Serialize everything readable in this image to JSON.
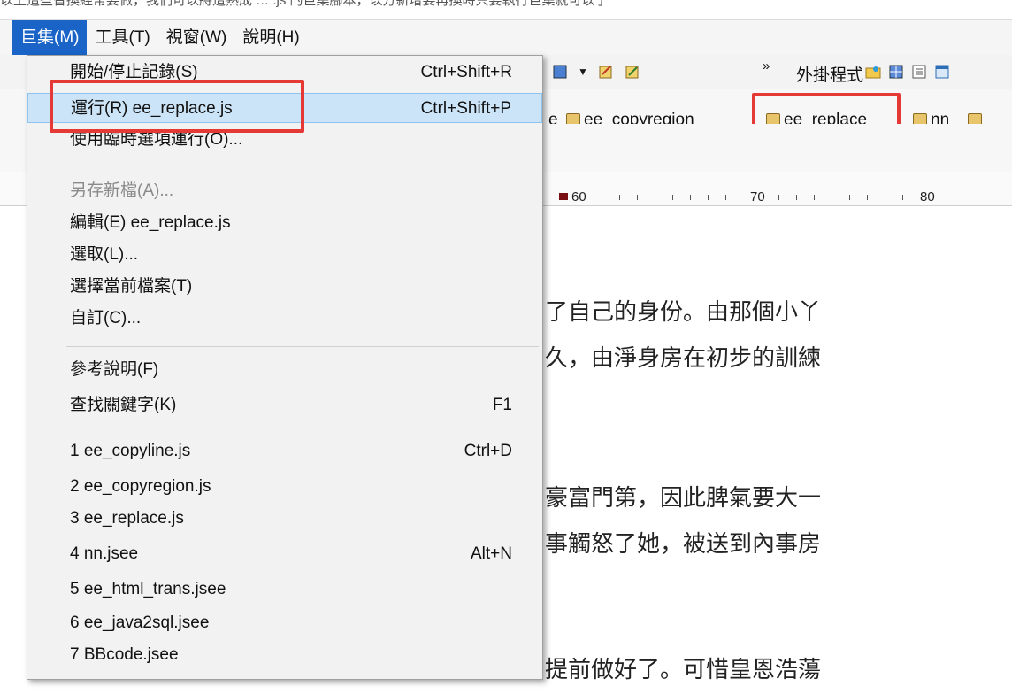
{
  "top_strip_text": "以上這些替換經常要做，我們可以將這熟成 … .js 的巨集腳本，以方新增要再換時只要執行巨集就可以了",
  "menubar": {
    "items": [
      "巨集(M)",
      "工具(T)",
      "視窗(W)",
      "說明(H)"
    ]
  },
  "toolbar": {
    "overflow_chevron": "»",
    "plugins_label": "外掛程式"
  },
  "macro_toolbar": {
    "buttons": [
      "e",
      "ee_copyregion",
      "ee_replace",
      "nn"
    ]
  },
  "ruler": {
    "marks": [
      "60",
      "70",
      "80"
    ]
  },
  "document": {
    "lines": [
      "了自己的身份。由那個小丫",
      "久，由淨身房在初步的訓練",
      "豪富門第，因此脾氣要大一",
      "事觸怒了她，被送到內事房",
      "提前做好了。可惜皇恩浩蕩"
    ]
  },
  "macro_menu": {
    "items": [
      {
        "label": "開始/停止記錄(S)",
        "shortcut": "Ctrl+Shift+R",
        "state": "normal"
      },
      {
        "label": "運行(R) ee_replace.js",
        "shortcut": "Ctrl+Shift+P",
        "state": "hover"
      },
      {
        "label": "使用臨時選項運行(O)...",
        "shortcut": "",
        "state": "normal"
      },
      {
        "label": "另存新檔(A)...",
        "shortcut": "",
        "state": "disabled"
      },
      {
        "label": "編輯(E) ee_replace.js",
        "shortcut": "",
        "state": "normal"
      },
      {
        "label": "選取(L)...",
        "shortcut": "",
        "state": "normal"
      },
      {
        "label": "選擇當前檔案(T)",
        "shortcut": "",
        "state": "normal"
      },
      {
        "label": "自訂(C)...",
        "shortcut": "",
        "state": "normal"
      },
      {
        "label": "參考說明(F)",
        "shortcut": "",
        "state": "normal"
      },
      {
        "label": "查找關鍵字(K)",
        "shortcut": "F1",
        "state": "normal"
      },
      {
        "label": "1 ee_copyline.js",
        "shortcut": "Ctrl+D",
        "state": "normal"
      },
      {
        "label": "2 ee_copyregion.js",
        "shortcut": "",
        "state": "normal"
      },
      {
        "label": "3 ee_replace.js",
        "shortcut": "",
        "state": "normal"
      },
      {
        "label": "4 nn.jsee",
        "shortcut": "Alt+N",
        "state": "normal"
      },
      {
        "label": "5 ee_html_trans.jsee",
        "shortcut": "",
        "state": "normal"
      },
      {
        "label": "6 ee_java2sql.jsee",
        "shortcut": "",
        "state": "normal"
      },
      {
        "label": "7 BBcode.jsee",
        "shortcut": "",
        "state": "normal"
      }
    ]
  },
  "colors": {
    "menu_active_bg": "#1a64c8",
    "hover_bg": "#cce4f7",
    "highlight_border": "#e53935"
  }
}
